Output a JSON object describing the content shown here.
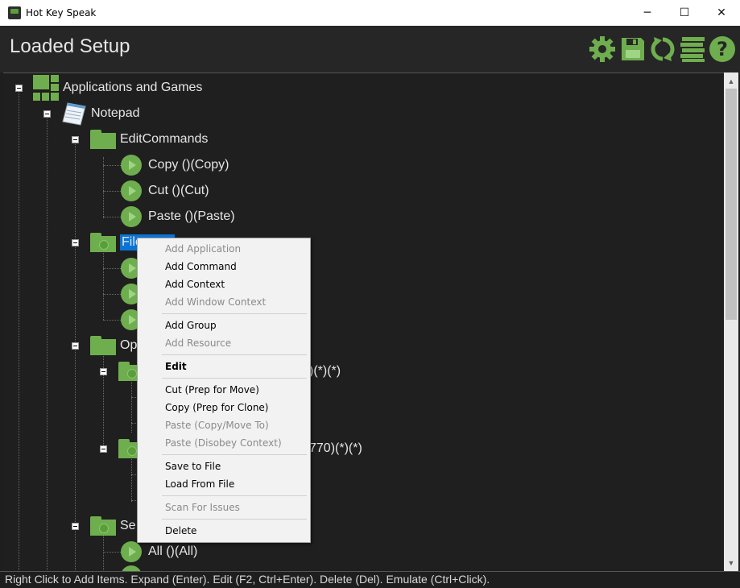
{
  "window": {
    "title": "Hot Key Speak",
    "minimize": "─",
    "maximize": "☐",
    "close": "✕"
  },
  "header": {
    "title": "Loaded Setup"
  },
  "toolbar": [
    "gear-icon",
    "save-icon",
    "refresh-icon",
    "list-icon",
    "help-icon"
  ],
  "tree": {
    "root": "Applications and Games",
    "notepad": "Notepad",
    "edit_commands": "EditCommands",
    "copy": "Copy ()(Copy)",
    "cut": "Cut ()(Cut)",
    "paste": "Paste ()(Paste)",
    "file_partial": "File",
    "op_partial": "Op",
    "op_child1_suffix": ")(*)(*)",
    "op_child2_suffix": "770)(*)(*)",
    "se_partial": "Se",
    "all": "All ()(All)"
  },
  "context_menu": {
    "add_application": "Add Application",
    "add_command": "Add Command",
    "add_context": "Add Context",
    "add_window_context": "Add Window Context",
    "add_group": "Add Group",
    "add_resource": "Add Resource",
    "edit": "Edit",
    "cut": "Cut (Prep for Move)",
    "copy": "Copy (Prep for Clone)",
    "paste_copy_move": "Paste (Copy/Move To)",
    "paste_disobey": "Paste (Disobey Context)",
    "save_to_file": "Save to File",
    "load_from_file": "Load From File",
    "scan_for_issues": "Scan For Issues",
    "delete": "Delete"
  },
  "status": "Right Click to Add Items. Expand (Enter). Edit (F2, Ctrl+Enter). Delete (Del). Emulate (Ctrl+Click).",
  "colors": {
    "accent_green": "#6fae4e",
    "selection_blue": "#0a74d6",
    "background": "#1f1f1f"
  }
}
